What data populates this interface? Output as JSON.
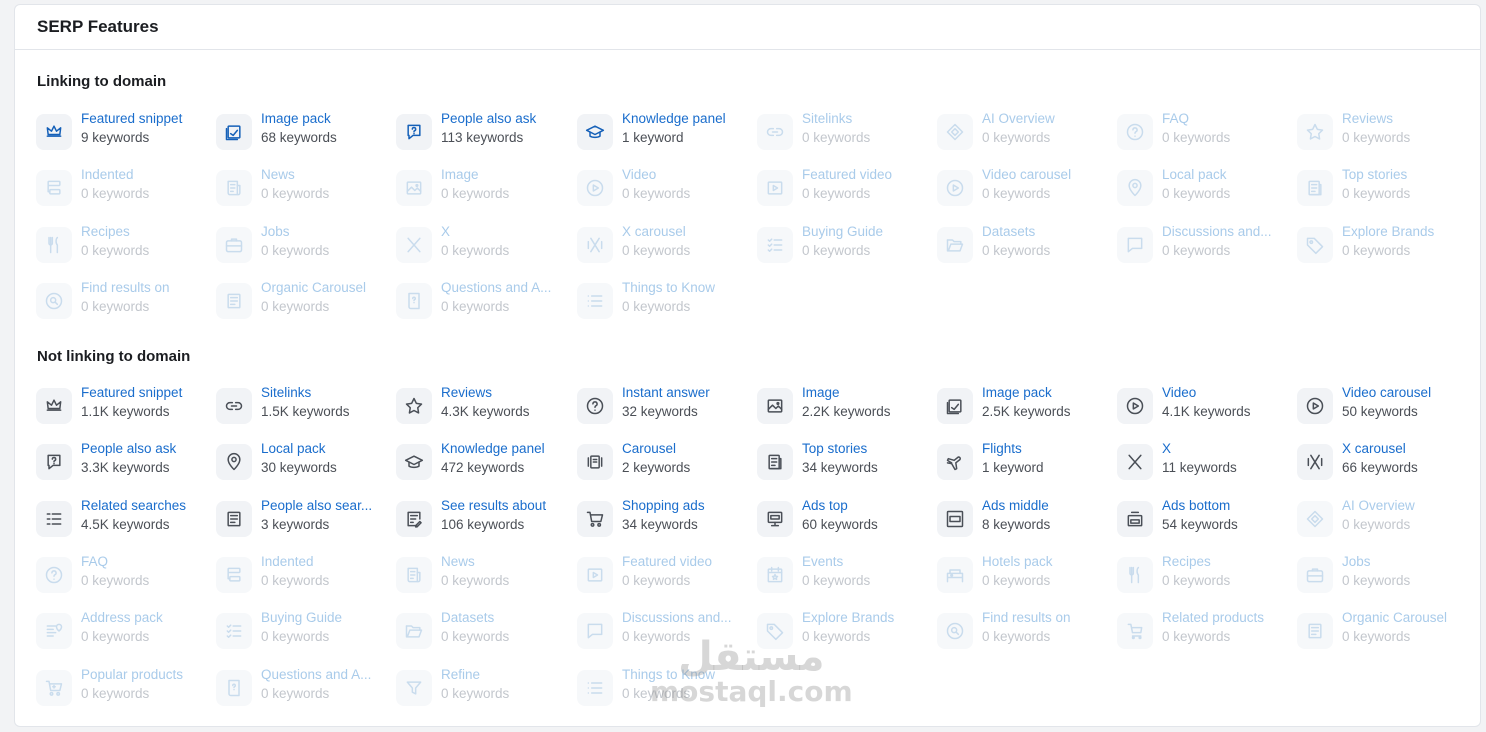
{
  "card": {
    "title": "SERP Features"
  },
  "sections": [
    {
      "title": "Linking to domain",
      "items": [
        {
          "label": "Featured snippet",
          "count": "9 keywords",
          "icon": "crown-icon",
          "active": true
        },
        {
          "label": "Image pack",
          "count": "68 keywords",
          "icon": "image-pack-icon",
          "active": true
        },
        {
          "label": "People also ask",
          "count": "113 keywords",
          "icon": "question-bubble-icon",
          "active": true
        },
        {
          "label": "Knowledge panel",
          "count": "1 keyword",
          "icon": "graduation-cap-icon",
          "active": true
        },
        {
          "label": "Sitelinks",
          "count": "0 keywords",
          "icon": "link-icon",
          "active": false
        },
        {
          "label": "AI Overview",
          "count": "0 keywords",
          "icon": "ai-diamond-icon",
          "active": false
        },
        {
          "label": "FAQ",
          "count": "0 keywords",
          "icon": "help-circle-icon",
          "active": false
        },
        {
          "label": "Reviews",
          "count": "0 keywords",
          "icon": "star-icon",
          "active": false
        },
        {
          "label": "Indented",
          "count": "0 keywords",
          "icon": "indent-icon",
          "active": false
        },
        {
          "label": "News",
          "count": "0 keywords",
          "icon": "news-icon",
          "active": false
        },
        {
          "label": "Image",
          "count": "0 keywords",
          "icon": "image-icon",
          "active": false
        },
        {
          "label": "Video",
          "count": "0 keywords",
          "icon": "play-circle-icon",
          "active": false
        },
        {
          "label": "Featured video",
          "count": "0 keywords",
          "icon": "video-box-icon",
          "active": false
        },
        {
          "label": "Video carousel",
          "count": "0 keywords",
          "icon": "play-circle-icon",
          "active": false
        },
        {
          "label": "Local pack",
          "count": "0 keywords",
          "icon": "location-pin-icon",
          "active": false
        },
        {
          "label": "Top stories",
          "count": "0 keywords",
          "icon": "top-stories-icon",
          "active": false
        },
        {
          "label": "Recipes",
          "count": "0 keywords",
          "icon": "fork-knife-icon",
          "active": false
        },
        {
          "label": "Jobs",
          "count": "0 keywords",
          "icon": "briefcase-icon",
          "active": false
        },
        {
          "label": "X",
          "count": "0 keywords",
          "icon": "x-logo-icon",
          "active": false
        },
        {
          "label": "X carousel",
          "count": "0 keywords",
          "icon": "x-carousel-icon",
          "active": false
        },
        {
          "label": "Buying Guide",
          "count": "0 keywords",
          "icon": "checklist-icon",
          "active": false
        },
        {
          "label": "Datasets",
          "count": "0 keywords",
          "icon": "folder-open-icon",
          "active": false
        },
        {
          "label": "Discussions and...",
          "count": "0 keywords",
          "icon": "chat-square-icon",
          "active": false
        },
        {
          "label": "Explore Brands",
          "count": "0 keywords",
          "icon": "tag-icon",
          "active": false
        },
        {
          "label": "Find results on",
          "count": "0 keywords",
          "icon": "search-circle-icon",
          "active": false
        },
        {
          "label": "Organic Carousel",
          "count": "0 keywords",
          "icon": "document-icon",
          "active": false
        },
        {
          "label": "Questions and A...",
          "count": "0 keywords",
          "icon": "book-question-icon",
          "active": false
        },
        {
          "label": "Things to Know",
          "count": "0 keywords",
          "icon": "list-icon",
          "active": false
        }
      ]
    },
    {
      "title": "Not linking to domain",
      "items": [
        {
          "label": "Featured snippet",
          "count": "1.1K keywords",
          "icon": "crown-icon",
          "active": true
        },
        {
          "label": "Sitelinks",
          "count": "1.5K keywords",
          "icon": "link-icon",
          "active": true
        },
        {
          "label": "Reviews",
          "count": "4.3K keywords",
          "icon": "star-icon",
          "active": true
        },
        {
          "label": "Instant answer",
          "count": "32 keywords",
          "icon": "help-circle-icon",
          "active": true
        },
        {
          "label": "Image",
          "count": "2.2K keywords",
          "icon": "image-icon",
          "active": true
        },
        {
          "label": "Image pack",
          "count": "2.5K keywords",
          "icon": "image-pack-icon",
          "active": true
        },
        {
          "label": "Video",
          "count": "4.1K keywords",
          "icon": "play-circle-icon",
          "active": true
        },
        {
          "label": "Video carousel",
          "count": "50 keywords",
          "icon": "play-circle-icon",
          "active": true
        },
        {
          "label": "People also ask",
          "count": "3.3K keywords",
          "icon": "question-bubble-icon",
          "active": true
        },
        {
          "label": "Local pack",
          "count": "30 keywords",
          "icon": "location-pin-icon",
          "active": true
        },
        {
          "label": "Knowledge panel",
          "count": "472 keywords",
          "icon": "graduation-cap-icon",
          "active": true
        },
        {
          "label": "Carousel",
          "count": "2 keywords",
          "icon": "carousel-icon",
          "active": true
        },
        {
          "label": "Top stories",
          "count": "34 keywords",
          "icon": "top-stories-icon",
          "active": true
        },
        {
          "label": "Flights",
          "count": "1 keyword",
          "icon": "plane-icon",
          "active": true
        },
        {
          "label": "X",
          "count": "11 keywords",
          "icon": "x-logo-icon",
          "active": true
        },
        {
          "label": "X carousel",
          "count": "66 keywords",
          "icon": "x-carousel-icon",
          "active": true
        },
        {
          "label": "Related searches",
          "count": "4.5K keywords",
          "icon": "related-list-icon",
          "active": true
        },
        {
          "label": "People also sear...",
          "count": "3 keywords",
          "icon": "document-icon",
          "active": true
        },
        {
          "label": "See results about",
          "count": "106 keywords",
          "icon": "edit-doc-icon",
          "active": true
        },
        {
          "label": "Shopping ads",
          "count": "34 keywords",
          "icon": "cart-icon",
          "active": true
        },
        {
          "label": "Ads top",
          "count": "60 keywords",
          "icon": "ad-top-icon",
          "active": true
        },
        {
          "label": "Ads middle",
          "count": "8 keywords",
          "icon": "ad-middle-icon",
          "active": true
        },
        {
          "label": "Ads bottom",
          "count": "54 keywords",
          "icon": "ad-bottom-icon",
          "active": true
        },
        {
          "label": "AI Overview",
          "count": "0 keywords",
          "icon": "ai-diamond-icon",
          "active": false
        },
        {
          "label": "FAQ",
          "count": "0 keywords",
          "icon": "help-circle-icon",
          "active": false
        },
        {
          "label": "Indented",
          "count": "0 keywords",
          "icon": "indent-icon",
          "active": false
        },
        {
          "label": "News",
          "count": "0 keywords",
          "icon": "news-icon",
          "active": false
        },
        {
          "label": "Featured video",
          "count": "0 keywords",
          "icon": "video-box-icon",
          "active": false
        },
        {
          "label": "Events",
          "count": "0 keywords",
          "icon": "calendar-star-icon",
          "active": false
        },
        {
          "label": "Hotels pack",
          "count": "0 keywords",
          "icon": "hotel-icon",
          "active": false
        },
        {
          "label": "Recipes",
          "count": "0 keywords",
          "icon": "fork-knife-icon",
          "active": false
        },
        {
          "label": "Jobs",
          "count": "0 keywords",
          "icon": "briefcase-icon",
          "active": false
        },
        {
          "label": "Address pack",
          "count": "0 keywords",
          "icon": "address-icon",
          "active": false
        },
        {
          "label": "Buying Guide",
          "count": "0 keywords",
          "icon": "checklist-icon",
          "active": false
        },
        {
          "label": "Datasets",
          "count": "0 keywords",
          "icon": "folder-open-icon",
          "active": false
        },
        {
          "label": "Discussions and...",
          "count": "0 keywords",
          "icon": "chat-square-icon",
          "active": false
        },
        {
          "label": "Explore Brands",
          "count": "0 keywords",
          "icon": "tag-icon",
          "active": false
        },
        {
          "label": "Find results on",
          "count": "0 keywords",
          "icon": "search-circle-icon",
          "active": false
        },
        {
          "label": "Related products",
          "count": "0 keywords",
          "icon": "cart-related-icon",
          "active": false
        },
        {
          "label": "Organic Carousel",
          "count": "0 keywords",
          "icon": "document-icon",
          "active": false
        },
        {
          "label": "Popular products",
          "count": "0 keywords",
          "icon": "cart-popular-icon",
          "active": false
        },
        {
          "label": "Questions and A...",
          "count": "0 keywords",
          "icon": "book-question-icon",
          "active": false
        },
        {
          "label": "Refine",
          "count": "0 keywords",
          "icon": "filter-icon",
          "active": false
        },
        {
          "label": "Things to Know",
          "count": "0 keywords",
          "icon": "list-icon",
          "active": false
        }
      ]
    }
  ],
  "watermark": {
    "arabic": "مستقل",
    "latin": "mostaql.com"
  }
}
